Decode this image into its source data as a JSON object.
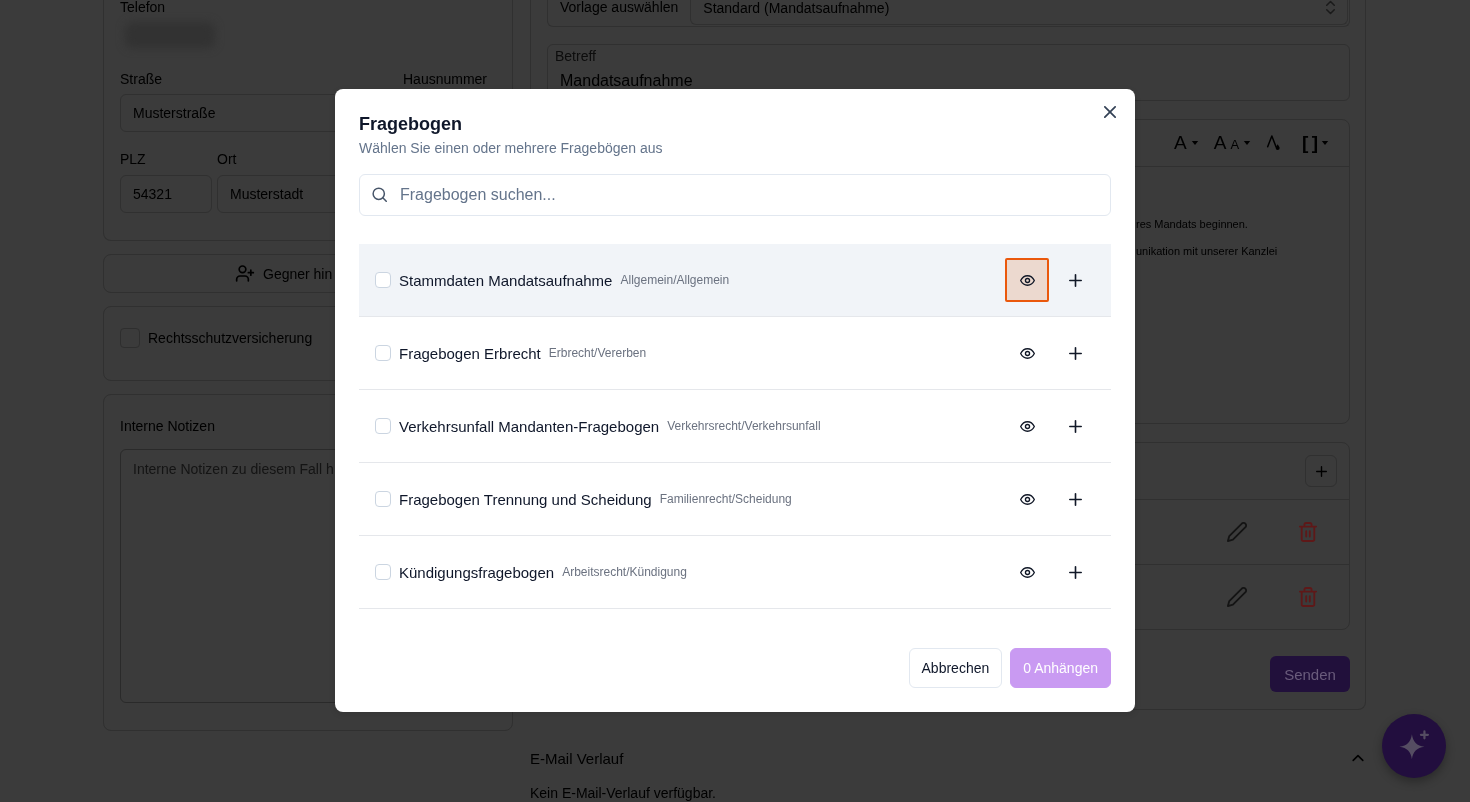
{
  "case_form": {
    "contact": {
      "phone_label": "Telefon",
      "street_label": "Straße",
      "street_value": "Musterstraße",
      "house_number_label": "Hausnummer",
      "zip_label": "PLZ",
      "zip_value": "54321",
      "city_label": "Ort",
      "city_value": "Musterstadt"
    },
    "add_opponent_button": {
      "label": "Gegner hin"
    },
    "legal_insurance": {
      "label": "Rechtsschutzversicherung",
      "checked": false
    },
    "notes": {
      "label": "Interne Notizen",
      "placeholder": "Interne Notizen zu diesem Fall h"
    }
  },
  "email_composer": {
    "template_label": "Vorlage auswählen",
    "template_value": "Standard (Mandatsaufnahme)",
    "subject_label": "Betreff",
    "subject_value": "Mandatsaufnahme",
    "toolbar": [
      {
        "kind": "font-color",
        "label": "A",
        "dropdown": true
      },
      {
        "kind": "font-size",
        "label": "A",
        "small_label": "A",
        "dropdown": true
      },
      {
        "kind": "highlight"
      },
      {
        "kind": "placeholder",
        "label": "[ ]",
        "dropdown": true
      }
    ],
    "body_lines": [
      "res Mandats beginnen.",
      "unikation mit unserer Kanzlei"
    ],
    "attachment_rows": [
      {
        "kind": "file"
      },
      {
        "kind": "file"
      }
    ],
    "send_button": {
      "label": "Senden"
    }
  },
  "email_history": {
    "title": "E-Mail Verlauf",
    "expanded": true,
    "empty_text": "Kein E-Mail-Verlauf verfügbar."
  },
  "dialog": {
    "title": "Fragebogen",
    "subtitle": "Wählen Sie einen oder mehrere Fragebögen aus",
    "search": {
      "placeholder": "Fragebogen suchen..."
    },
    "questionnaires": [
      {
        "title": "Stammdaten Mandatsaufnahme",
        "category": "Allgemein/Allgemein",
        "checked": false,
        "hovered": true,
        "preview_focused": true
      },
      {
        "title": "Fragebogen Erbrecht",
        "category": "Erbrecht/Vererben",
        "checked": false,
        "hovered": false,
        "preview_focused": false
      },
      {
        "title": "Verkehrsunfall Mandanten-Fragebogen",
        "category": "Verkehrsrecht/Verkehrsunfall",
        "checked": false,
        "hovered": false,
        "preview_focused": false
      },
      {
        "title": "Fragebogen Trennung und Scheidung",
        "category": "Familienrecht/Scheidung",
        "checked": false,
        "hovered": false,
        "preview_focused": false
      },
      {
        "title": "Kündigungsfragebogen",
        "category": "Arbeitsrecht/Kündigung",
        "checked": false,
        "hovered": false,
        "preview_focused": false
      }
    ],
    "buttons": [
      {
        "kind": "cancel",
        "label": "Abbrechen",
        "disabled": false
      },
      {
        "kind": "attach",
        "label": "0 Anhängen",
        "disabled": true
      }
    ]
  }
}
